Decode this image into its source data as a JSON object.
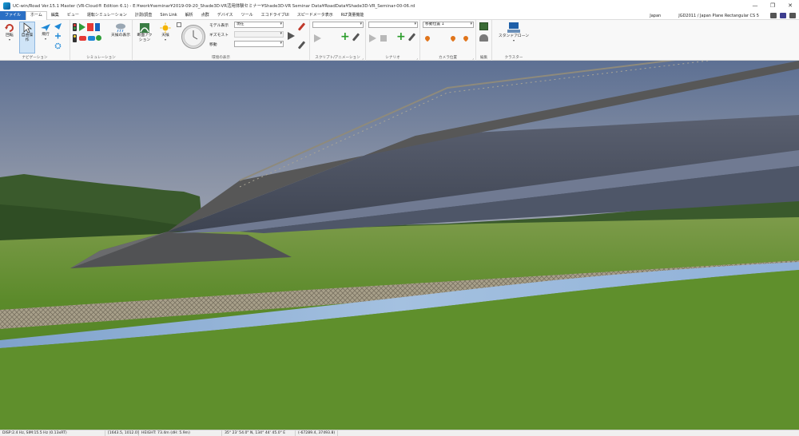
{
  "window": {
    "title": "UC-win/Road Ver.15.1 Master (VR-Cloud® Edition 6.1) - E:¥work¥seminar¥2019-09-20_Shade3D-VR活用体験セミナー¥Shade3D-VR Seminar Data¥RoadData¥Shade3D-VR_Seminar-00-06.rd",
    "minimize": "—",
    "maximize": "❐",
    "close": "✕"
  },
  "menu": {
    "file": "ファイル",
    "items": [
      "ホーム",
      "編集",
      "ビュー",
      "運転シミュレーション",
      "計測/調査",
      "Sim Link",
      "解析",
      "点群",
      "デバイス",
      "ツール",
      "エコドライブUI",
      "スピードメータ表示",
      "RLT測量機能"
    ],
    "region": "Japan",
    "coord_system": "JGD2011 / Japan Plane Rectangular CS 5"
  },
  "ribbon": {
    "nav": {
      "rotate": "回転",
      "free": "自由操作",
      "fly": "飛行",
      "label": "ナビゲーション"
    },
    "sim": {
      "weather_display": "天候の表示",
      "label": "シミュレーション"
    },
    "env": {
      "cross_section": "断面アクション",
      "weather": "天候"
    },
    "time": {
      "model_label": "モデル表示",
      "model_value": "現在",
      "gizmo_label": "ギズモスト",
      "move_label": "移動",
      "label": "環境の表示"
    },
    "script": {
      "label": "スクリプト/アニメーション"
    },
    "scenario": {
      "label": "シナリオ"
    },
    "camera": {
      "combo": "移動位置 1",
      "label": "カメラ位置"
    },
    "edit": {
      "label": "編集"
    },
    "cluster": {
      "start": "スタンドアローン",
      "label": "クラスター"
    }
  },
  "status": {
    "fps": "DISP:2.4 Hz, SIM:15.5 Hz (0.13xRT)",
    "xy": "[1643.5, 1012.0]",
    "height": "HEIGHT: 73.4m (dH: 5.9m)",
    "latlon": "35° 23' 54.0\" N, 134° 44' 45.0\" E",
    "coords": "(-67289.4, 37493.8)"
  },
  "colors": {
    "sky_top": "#5d7093",
    "sky_bottom": "#a9aeb8",
    "grass": "#5b8a2a",
    "river": "#8fb0d8",
    "bridge": "#4b525e",
    "file_menu": "#2b6fc4"
  }
}
